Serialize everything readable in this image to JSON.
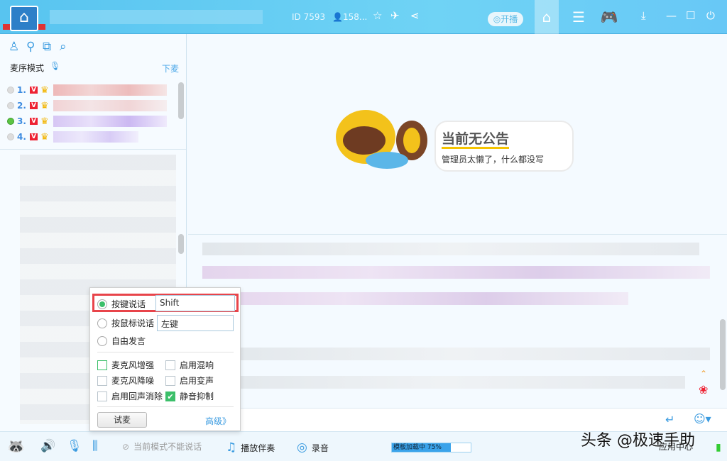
{
  "titlebar": {
    "room_id": "ID 7593",
    "online": "158...",
    "live_button": "开播",
    "icons": [
      "home-icon",
      "list-icon",
      "gamepad-icon",
      "download-icon",
      "minimize-icon",
      "maximize-icon",
      "power-icon",
      "star-icon",
      "plane-icon",
      "share-icon",
      "user-icon"
    ]
  },
  "left": {
    "mode_label": "麦序模式",
    "down_mic": "下麦",
    "queue": [
      {
        "num": "1."
      },
      {
        "num": "2."
      },
      {
        "num": "3."
      },
      {
        "num": "4."
      }
    ],
    "badge": "V"
  },
  "notice": {
    "title": "当前无公告",
    "subtitle": "管理员太懒了，什么都没写"
  },
  "popup": {
    "options": [
      {
        "label": "按键说话",
        "value": "Shift",
        "selected": true
      },
      {
        "label": "按鼠标说话",
        "value": "左键",
        "selected": false
      },
      {
        "label": "自由发言",
        "selected": false
      }
    ],
    "checkboxes": [
      {
        "label": "麦克风增强",
        "checked": false
      },
      {
        "label": "启用混响",
        "checked": false
      },
      {
        "label": "麦克风降噪",
        "checked": false
      },
      {
        "label": "启用变声",
        "checked": false
      },
      {
        "label": "启用回声消除",
        "checked": false
      },
      {
        "label": "静音抑制",
        "checked": true
      }
    ],
    "try_button": "试麦",
    "advanced": "高级》"
  },
  "bottom": {
    "mode_text": "当前模式不能说话",
    "play_music": "播放伴奏",
    "record": "录音",
    "template_loading": "模板加载中 75%",
    "progress_percent": 75,
    "app_center": "应用中心"
  },
  "watermark": "头条 @极速手助",
  "colors": {
    "accent": "#3a9be0",
    "titlebar": "#5ec8f2",
    "highlight": "#e8444a",
    "check": "#3cbf6a"
  }
}
